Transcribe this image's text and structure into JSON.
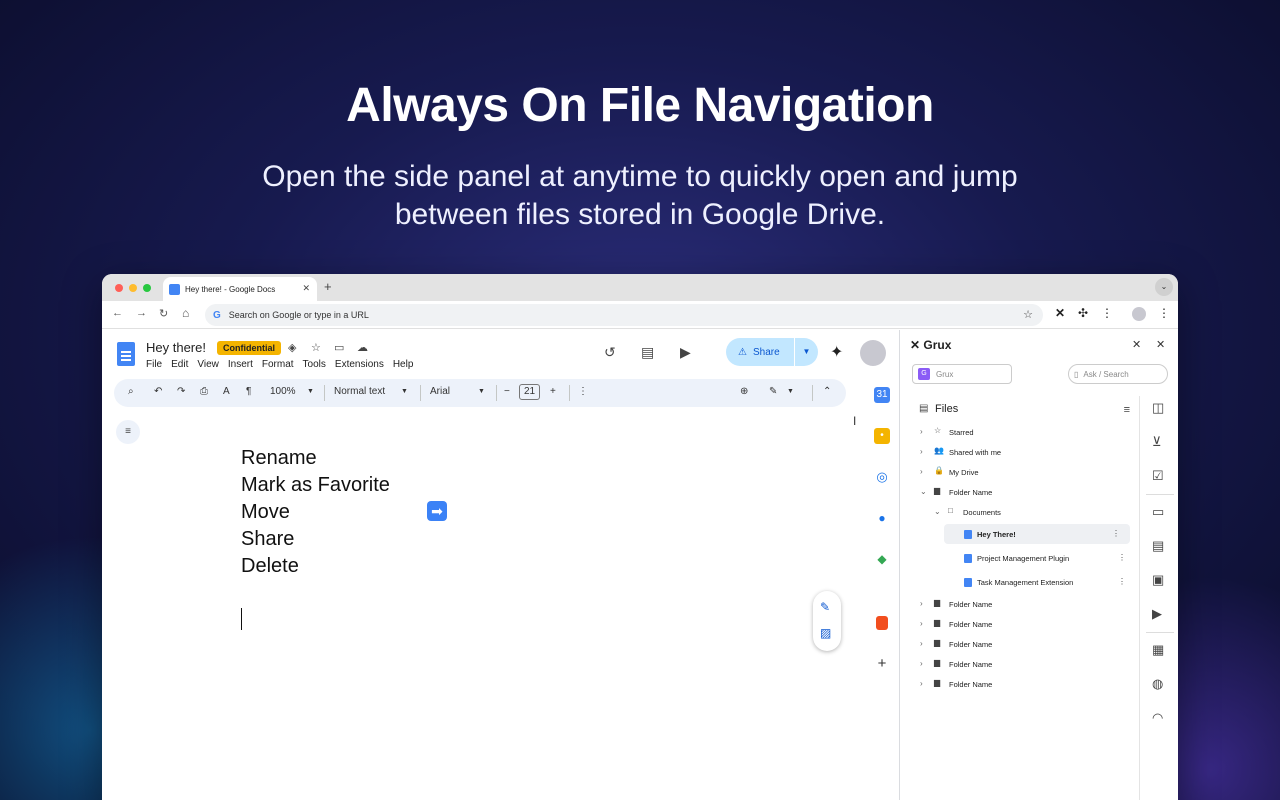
{
  "hero": {
    "title": "Always On File Navigation",
    "subtitle": "Open the side panel at anytime to quickly open and jump between files stored in Google Drive."
  },
  "browser": {
    "tab_title": "Hey there! - Google Docs",
    "tab_close": "✕",
    "new_tab": "+",
    "omnibox_placeholder": "Search on Google or type in a URL",
    "nav_back": "←",
    "nav_forward": "→",
    "nav_reload": "↻",
    "nav_home": "⌂",
    "bookmark_star": "☆",
    "menu": "⋮",
    "tab_menu": "⌄"
  },
  "docs": {
    "title": "Hey there!",
    "badge": "Confidential",
    "menu": [
      "File",
      "Edit",
      "View",
      "Insert",
      "Format",
      "Tools",
      "Extensions",
      "Help"
    ],
    "share_label": "Share",
    "toolbar": {
      "zoom": "100%",
      "style": "Normal text",
      "font": "Arial",
      "font_size": "21"
    },
    "body_lines": [
      "Rename",
      "Mark as Favorite",
      "Move",
      "Share",
      "Delete"
    ],
    "arrow_emoji": "➡"
  },
  "grux": {
    "app_name": "Grux",
    "workspace": "Grux",
    "search_placeholder": "Ask / Search",
    "files_title": "Files",
    "tree": [
      {
        "label": "Starred",
        "level": 0,
        "icon": "star-icon",
        "glyph": "☆",
        "chevron": "›"
      },
      {
        "label": "Shared with me",
        "level": 0,
        "icon": "people-icon",
        "glyph": "👥",
        "chevron": "›"
      },
      {
        "label": "My Drive",
        "level": 0,
        "icon": "lock-icon",
        "glyph": "🔒",
        "chevron": "›"
      },
      {
        "label": "Folder Name",
        "level": 0,
        "icon": "folder-icon",
        "glyph": "▆",
        "chevron": "⌄"
      },
      {
        "label": "Documents",
        "level": 1,
        "icon": "folder-outline-icon",
        "glyph": "□",
        "chevron": "⌄"
      },
      {
        "label": "Hey There!",
        "level": 2,
        "icon": "doc-icon",
        "active": true
      },
      {
        "label": "Project Management Plugin",
        "level": 2,
        "icon": "doc-icon"
      },
      {
        "label": "Task Management Extension",
        "level": 2,
        "icon": "doc-icon"
      },
      {
        "label": "Folder Name",
        "level": 0,
        "icon": "folder-icon",
        "glyph": "▆",
        "chevron": "›"
      },
      {
        "label": "Folder Name",
        "level": 0,
        "icon": "folder-icon",
        "glyph": "▆",
        "chevron": "›"
      },
      {
        "label": "Folder Name",
        "level": 0,
        "icon": "folder-icon",
        "glyph": "▆",
        "chevron": "›"
      },
      {
        "label": "Folder Name",
        "level": 0,
        "icon": "folder-icon",
        "glyph": "▆",
        "chevron": "›"
      },
      {
        "label": "Folder Name",
        "level": 0,
        "icon": "folder-icon",
        "glyph": "▆",
        "chevron": "›"
      }
    ]
  },
  "colors": {
    "accent_blue": "#4285f4",
    "badge_yellow": "#f4b400",
    "share_bg": "#c2e7ff",
    "grux_purple": "#8b5cf6"
  }
}
